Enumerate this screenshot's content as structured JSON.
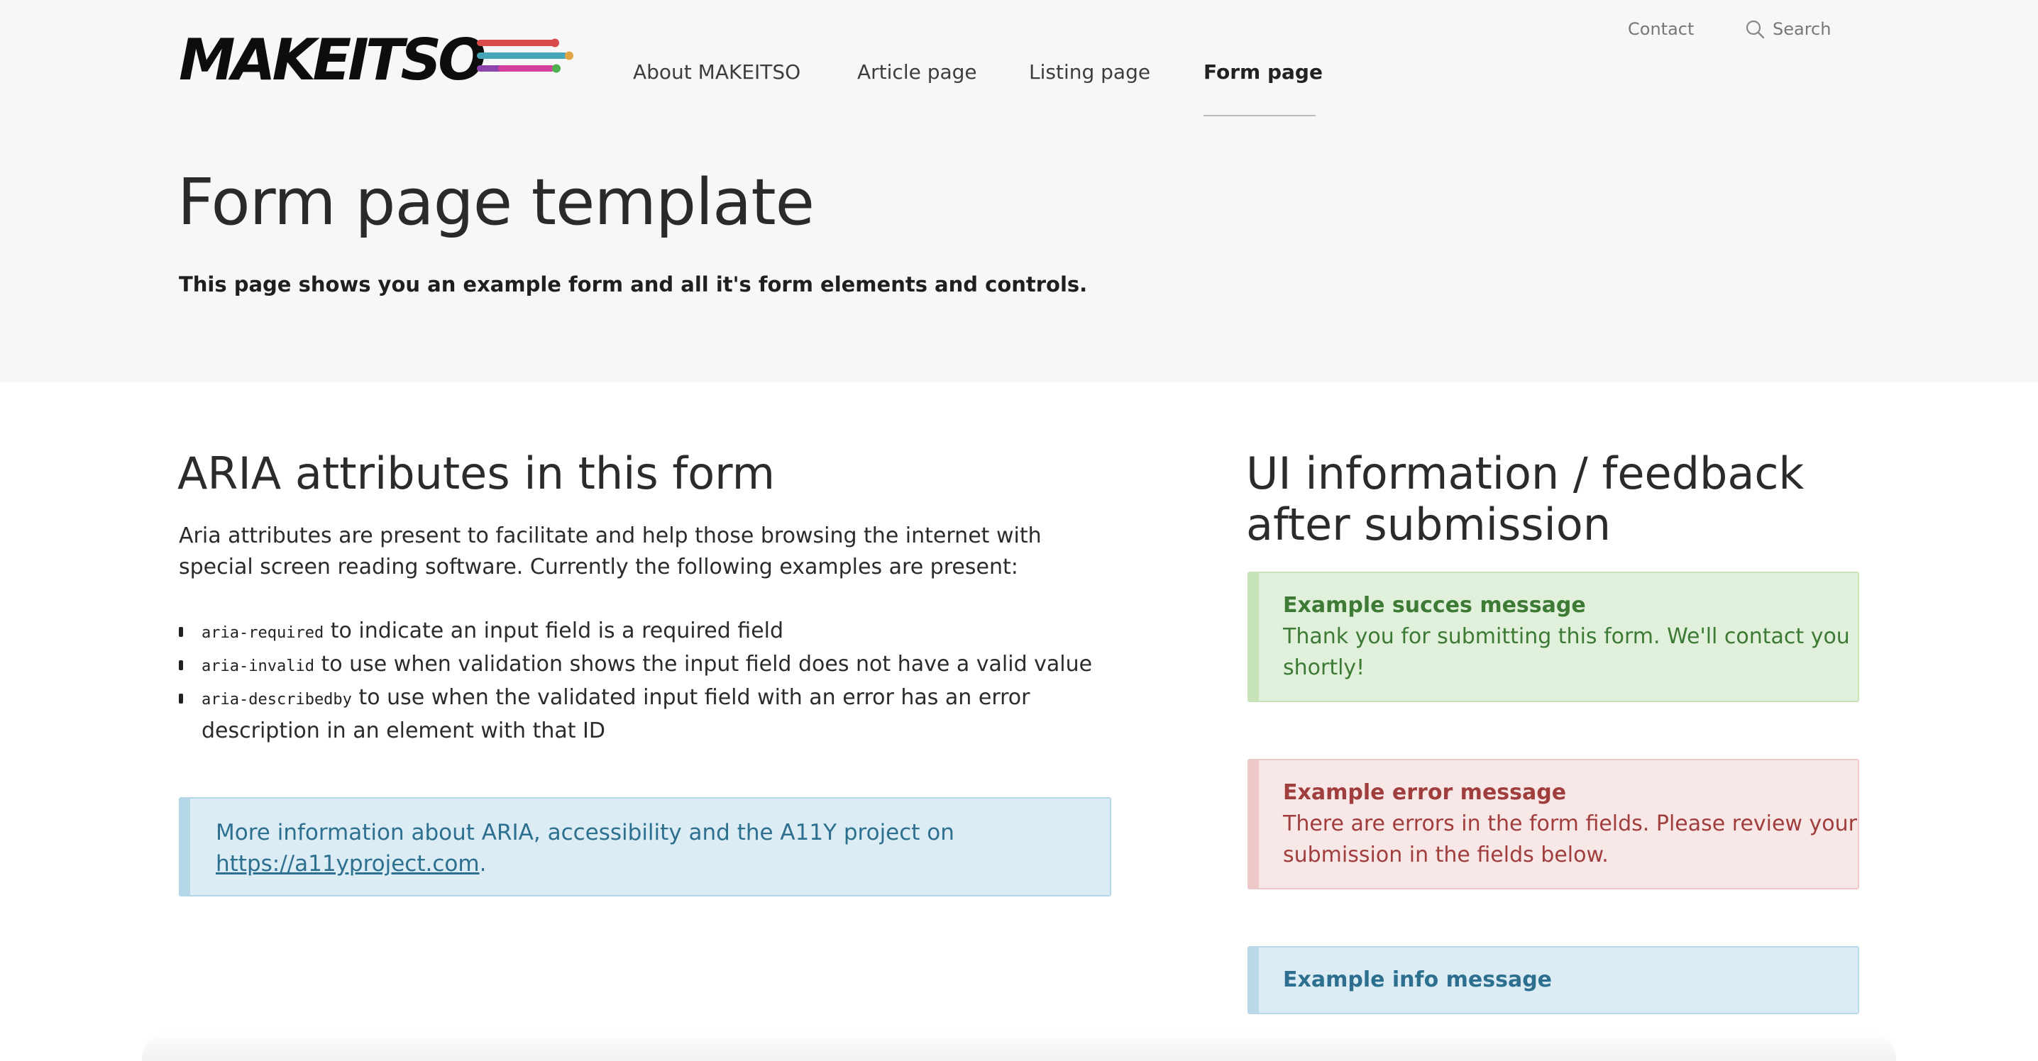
{
  "header": {
    "logo_text": "MAKEITSO",
    "nav": [
      {
        "label": "About MAKEITSO"
      },
      {
        "label": "Article page"
      },
      {
        "label": "Listing page"
      },
      {
        "label": "Form page",
        "active": true
      }
    ],
    "utility": {
      "contact": "Contact",
      "search": "Search",
      "search_icon": "magnifier"
    },
    "logo_colors": [
      "#d94a4a",
      "#e3a444",
      "#46a5b8",
      "#8e44ad",
      "#d63f9c",
      "#4caf50"
    ]
  },
  "hero": {
    "title": "Form page template",
    "intro": "This page shows you an example form and all it's form elements and controls."
  },
  "aria_section": {
    "heading": "ARIA attributes in this form",
    "paragraph": "Aria attributes are present to facilitate and help those browsing the internet with special screen reading software. Currently the following examples are present:",
    "items": [
      {
        "code": "aria-required",
        "text": " to indicate an input field is a required field"
      },
      {
        "code": "aria-invalid",
        "text": " to use when validation shows the input field does not have a valid value"
      },
      {
        "code": "aria-describedby",
        "text": " to use when the validated input field with an error has an error description in an element with that ID"
      }
    ],
    "callout_text": "More information about ARIA, accessibility and the A11Y project on ",
    "callout_link": "https://a11yproject.com",
    "callout_after": "."
  },
  "feedback_section": {
    "heading_line1": "UI information / feedback",
    "heading_line2": "after submission",
    "success": {
      "title": "Example succes message",
      "text": "Thank you for submitting this form. We'll contact you shortly!",
      "color": "#3c7a36"
    },
    "error": {
      "title": "Example error message",
      "text": "There are errors in the form fields. Please review your submission in the fields below.",
      "color": "#a03d3d"
    },
    "info": {
      "title": "Example info message",
      "color": "#2d6f8f"
    }
  }
}
